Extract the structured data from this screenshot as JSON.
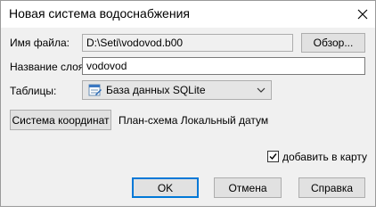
{
  "window": {
    "title": "Новая система водоснабжения"
  },
  "form": {
    "file_name_label": "Имя файла:",
    "file_name_value": "D:\\Seti\\vodovod.b00",
    "browse_label": "Обзор...",
    "layer_name_label": "Название слоя:",
    "layer_name_value": "vodovod",
    "tables_label": "Таблицы:",
    "tables_selected": "База данных SQLite",
    "coord_system_button": "Система координат",
    "coord_system_value": "План-схема Локальный датум"
  },
  "add_to_map": {
    "label": "добавить в карту",
    "checked": true
  },
  "buttons": {
    "ok": "OK",
    "cancel": "Отмена",
    "help": "Справка"
  },
  "icons": {
    "close": "close-icon",
    "database": "database-icon",
    "dropdown": "chevron-down-icon",
    "check": "checkmark-icon"
  }
}
